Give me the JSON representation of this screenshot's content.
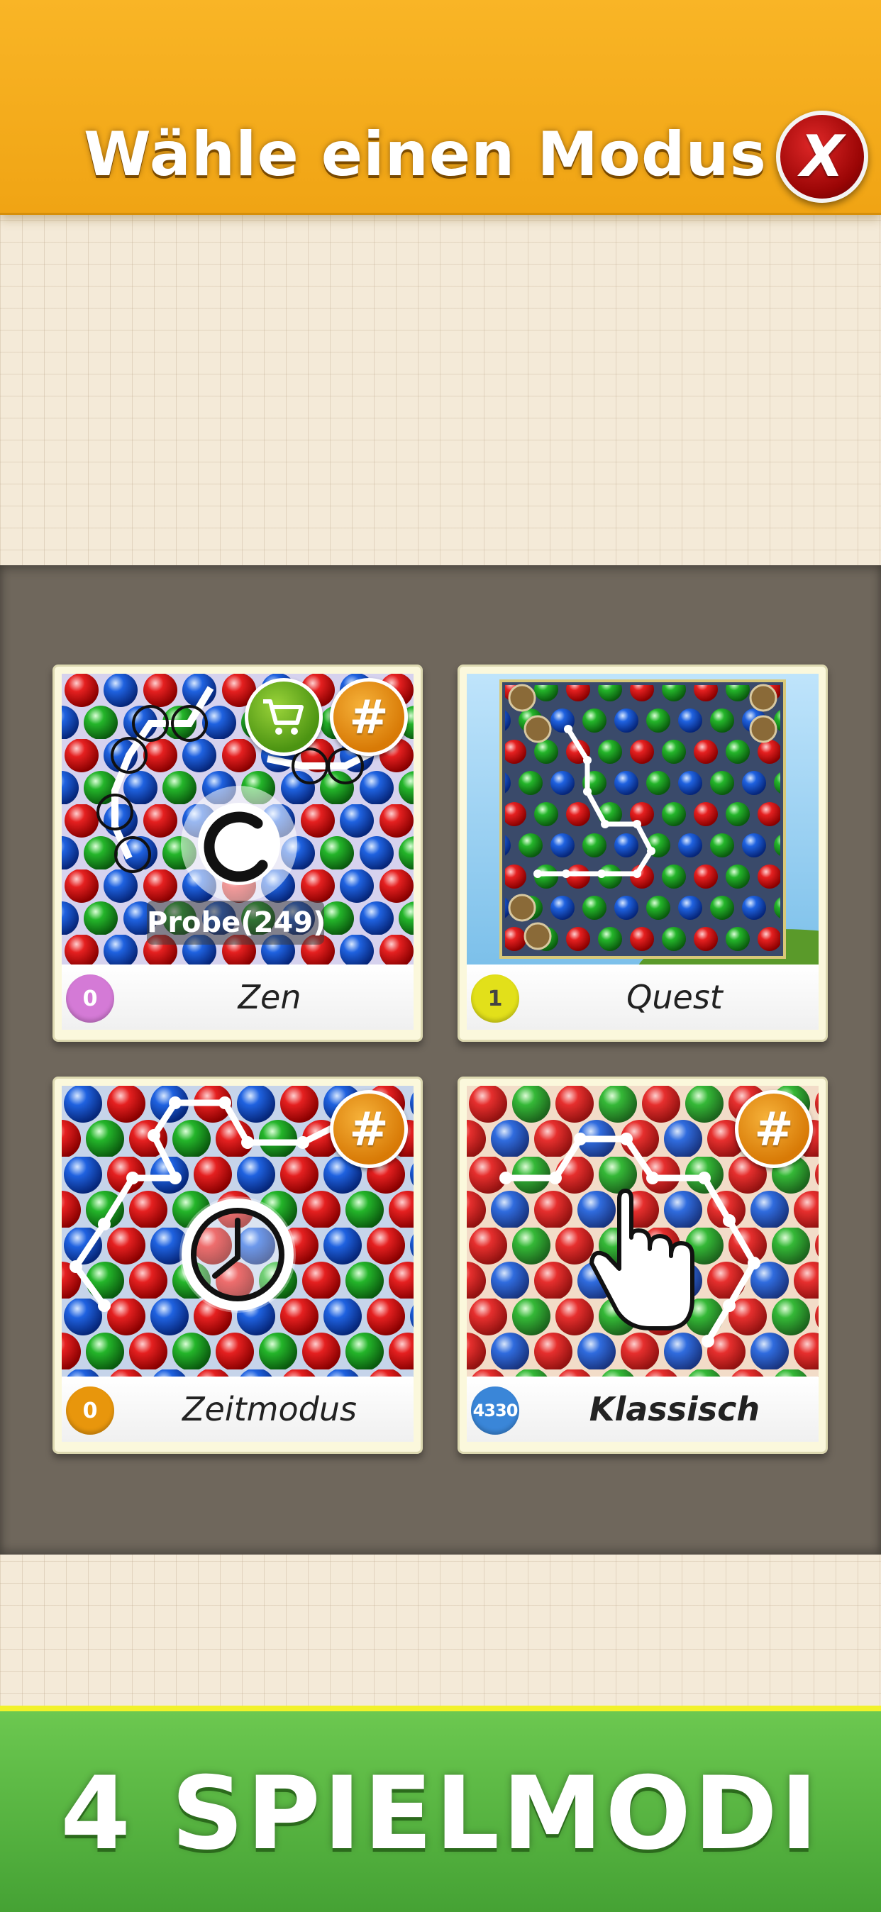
{
  "header": {
    "title": "Wähle einen Modus",
    "close_label": "X"
  },
  "modes": [
    {
      "label": "Zen",
      "count": "0",
      "badge_color": "#d47ad6",
      "hash": "#",
      "trial_label": "Probe(249)",
      "has_cart": true
    },
    {
      "label": "Quest",
      "count": "1",
      "badge_color": "#e2e01a"
    },
    {
      "label": "Zeitmodus",
      "count": "0",
      "badge_color": "#e8960c",
      "hash": "#"
    },
    {
      "label": "Klassisch",
      "count": "4330",
      "badge_color": "#3a86d8",
      "hash": "#"
    }
  ],
  "footer": {
    "text": "4 SPIELMODI"
  },
  "colors": {
    "header": "#f4a91d",
    "panel": "#6f675c",
    "footer": "#56b441",
    "close_button": "#b50d0d"
  }
}
